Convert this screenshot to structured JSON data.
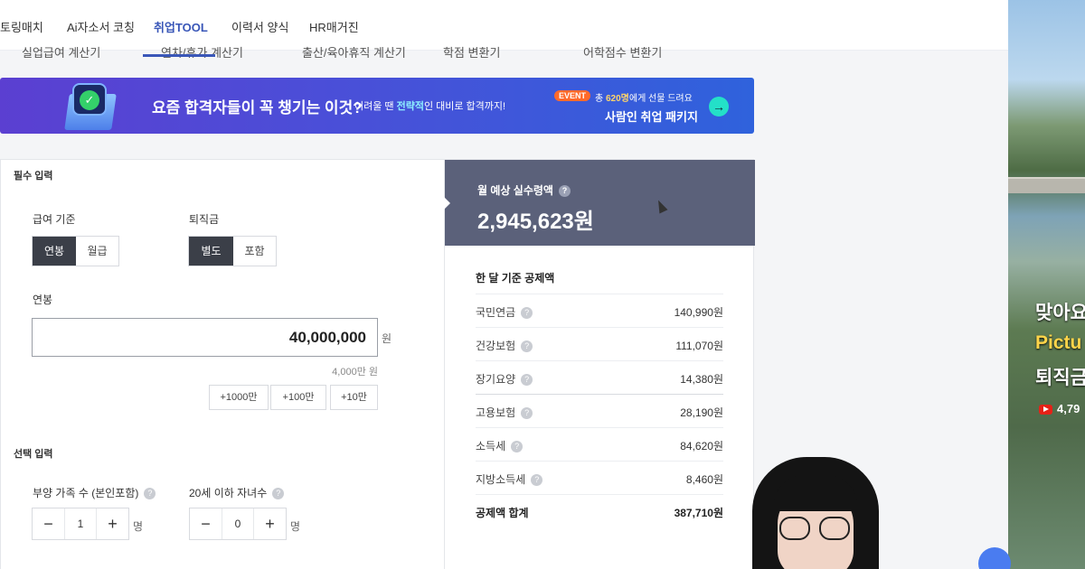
{
  "nav": {
    "items": [
      {
        "label": "토링매치",
        "active": false
      },
      {
        "label": "Ai자소서 코칭",
        "active": false
      },
      {
        "label": "취업TOOL",
        "active": true
      },
      {
        "label": "이력서 양식",
        "active": false
      },
      {
        "label": "HR매거진",
        "active": false
      }
    ]
  },
  "subtabs": [
    "실업급여 계산기",
    "연차/휴가 계산기",
    "출산/육아휴직 계산기",
    "학점 변환기",
    "어학점수 변환기"
  ],
  "banner": {
    "headline": "요즘 합격자들이 꼭 챙기는 이것?",
    "sub_prefix": "어려울 땐 ",
    "sub_emph": "전략적",
    "sub_suffix": "인 대비로 합격까지!",
    "event_badge": "EVENT",
    "event_prefix": "총 ",
    "event_emph": "620명",
    "event_suffix": "에게 선물 드려요",
    "package": "사람인 취업 패키지",
    "arrow": "→"
  },
  "form": {
    "required_title": "필수 입력",
    "salary_basis_label": "급여 기준",
    "salary_basis_options": [
      "연봉",
      "월급"
    ],
    "salary_basis_selected": "연봉",
    "severance_label": "퇴직금",
    "severance_options": [
      "별도",
      "포함"
    ],
    "severance_selected": "별도",
    "annual_label": "연봉",
    "annual_value": "40,000,000",
    "annual_unit": "원",
    "annual_hint": "4,000만 원",
    "add_buttons": [
      "+1000만",
      "+100만",
      "+10만"
    ],
    "optional_title": "선택 입력",
    "dependents_label": "부양 가족 수 (본인포함)",
    "dependents_value": "1",
    "children_label": "20세 이하 자녀수",
    "children_value": "0",
    "person_unit": "명",
    "minus": "−",
    "plus": "+"
  },
  "result": {
    "monthly_title": "월 예상 실수령액",
    "monthly_amount": "2,945,623원",
    "deduction_title": "한 달 기준 공제액",
    "rows": [
      {
        "name": "국민연금",
        "value": "140,990원"
      },
      {
        "name": "건강보험",
        "value": "111,070원"
      },
      {
        "name": "장기요양",
        "value": "14,380원"
      },
      {
        "name": "고용보험",
        "value": "28,190원"
      },
      {
        "name": "소득세",
        "value": "84,620원"
      },
      {
        "name": "지방소득세",
        "value": "8,460원"
      }
    ],
    "total_name": "공제액 합계",
    "total_value": "387,710원"
  },
  "side_video": {
    "line1": "맞아요",
    "line2": "Pictu",
    "line3": "퇴직금",
    "views": "4,79"
  },
  "colors": {
    "accent": "#3a57b8",
    "result_header": "#5b617a",
    "selected_segment": "#3b3f48"
  }
}
